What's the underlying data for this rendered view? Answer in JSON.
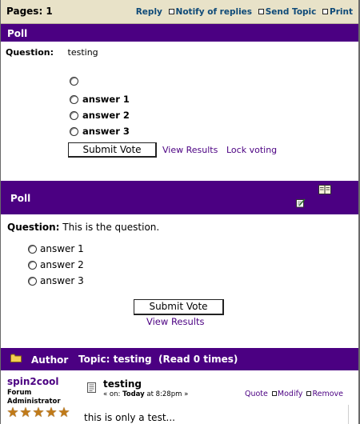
{
  "topbar": {
    "pages_label": "Pages: 1",
    "nav": [
      "Reply",
      "Notify of replies",
      "Send Topic",
      "Print"
    ]
  },
  "poll1": {
    "header": "Poll",
    "question_label": "Question:",
    "question_text": "testing",
    "options": [
      "",
      "answer 1",
      "answer 2",
      "answer 3"
    ],
    "submit_label": "Submit Vote",
    "view_results": "View Results",
    "lock_voting": "Lock voting"
  },
  "poll2": {
    "header": "Poll",
    "question_label": "Question:",
    "question_text": "This is the question.",
    "options": [
      "answer 1",
      "answer 2",
      "answer 3"
    ],
    "submit_label": "Submit Vote",
    "view_results": "View Results"
  },
  "thread": {
    "author_label": "Author",
    "topic_label": "Topic: testing  (Read 0 times)"
  },
  "post": {
    "username": "spin2cool",
    "role_line1": "Forum",
    "role_line2": "Administrator",
    "stars": 5,
    "title": "testing",
    "date_prefix": "« on: ",
    "date_day": "Today",
    "date_suffix": " at 8:28pm »",
    "actions": [
      "Quote",
      "Modify",
      "Remove"
    ],
    "body": "this is only a test..."
  },
  "colors": {
    "header_purple": "#4b0082",
    "topbar_bg": "#e8e2c8",
    "topnav_blue": "#0f4a78",
    "star_gold": "#c07a18"
  }
}
